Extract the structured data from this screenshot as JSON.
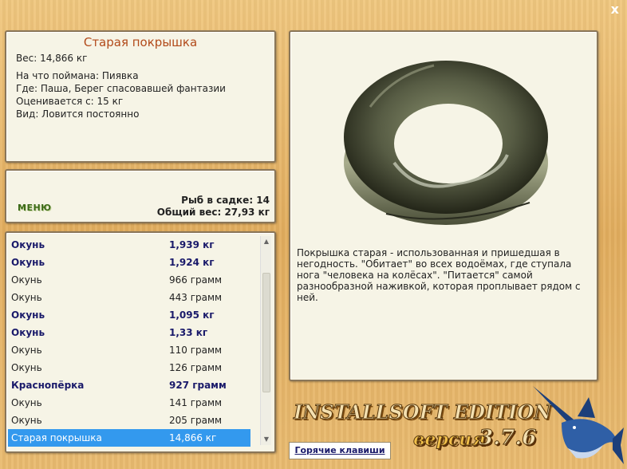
{
  "window": {
    "close_glyph": "x"
  },
  "item": {
    "title": "Старая покрышка",
    "weight": "Вес: 14,866 кг",
    "bait": "На что поймана: Пиявка",
    "where": "Где: Паша, Берег спасовавшей фантазии",
    "valued": "Оценивается с: 15 кг",
    "kind": "Вид: Ловится постоянно"
  },
  "menu": {
    "button_label": "МЕНЮ",
    "fish_in_keepnet": "Рыб в садке: 14",
    "total_weight": "Общий вес: 27,93 кг"
  },
  "catch_list": [
    {
      "name": "Окунь",
      "weight": "1,939 кг",
      "bold": true
    },
    {
      "name": "Окунь",
      "weight": "1,924 кг",
      "bold": true
    },
    {
      "name": "Окунь",
      "weight": "966 грамм",
      "bold": false
    },
    {
      "name": "Окунь",
      "weight": "443 грамм",
      "bold": false
    },
    {
      "name": "Окунь",
      "weight": "1,095 кг",
      "bold": true
    },
    {
      "name": "Окунь",
      "weight": "1,33 кг",
      "bold": true
    },
    {
      "name": "Окунь",
      "weight": "110 грамм",
      "bold": false
    },
    {
      "name": "Окунь",
      "weight": "126 грамм",
      "bold": false
    },
    {
      "name": "Краснопёрка",
      "weight": "927 грамм",
      "bold": true
    },
    {
      "name": "Окунь",
      "weight": "141 грамм",
      "bold": false
    },
    {
      "name": "Окунь",
      "weight": "205 грамм",
      "bold": false
    },
    {
      "name": "Старая покрышка",
      "weight": "14,866 кг",
      "bold": false,
      "selected": true
    }
  ],
  "description": "Покрышка старая - использованная и пришедшая в негодность. \"Обитает\" во всех водоёмах, где ступала нога \"человека на колёсах\". \"Питается\" самой разнообразной наживкой, которая проплывает рядом с ней.",
  "branding": {
    "edition": "INSTALLSOFT EDITION",
    "version_label": "версия",
    "version_number": "3.7.6"
  },
  "hotkeys_button": "Горячие клавиши",
  "colors": {
    "selection": "#3399ee",
    "bold_row": "#1a1a6a",
    "title": "#b24a1a"
  }
}
